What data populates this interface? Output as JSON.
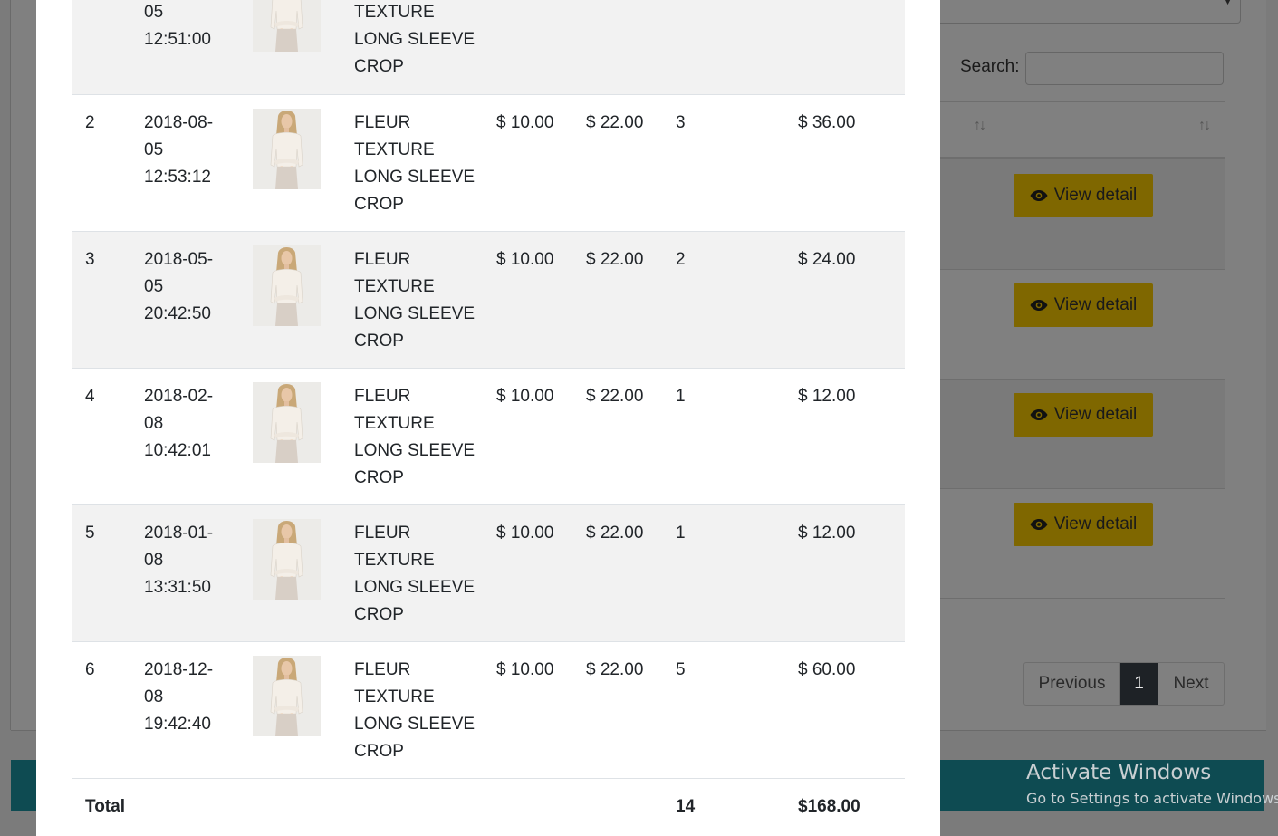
{
  "background": {
    "search_label": "Search:",
    "sort_icons": [
      "↑↓",
      "↑↓"
    ],
    "view_detail_buttons": [
      "View detail",
      "View detail",
      "View detail",
      "View detail"
    ],
    "pagination": {
      "previous": "Previous",
      "current": "1",
      "next": "Next"
    }
  },
  "watermark": {
    "title": "Activate Windows",
    "subtitle": "Go to Settings to activate Windows."
  },
  "modal": {
    "first_row_partial": {
      "date_lines": [
        "05",
        "12:51:00"
      ],
      "name_lines": [
        "TEXTURE",
        "LONG SLEEVE",
        "CROP"
      ]
    },
    "rows": [
      {
        "no": "2",
        "date_lines": [
          "2018-08-",
          "05",
          "12:53:12"
        ],
        "name_lines": [
          "FLEUR",
          "TEXTURE",
          "LONG SLEEVE",
          "CROP"
        ],
        "cost": "$ 10.00",
        "price": "$ 22.00",
        "qty": "3",
        "total": "$ 36.00"
      },
      {
        "no": "3",
        "date_lines": [
          "2018-05-",
          "05",
          "20:42:50"
        ],
        "name_lines": [
          "FLEUR",
          "TEXTURE",
          "LONG SLEEVE",
          "CROP"
        ],
        "cost": "$ 10.00",
        "price": "$ 22.00",
        "qty": "2",
        "total": "$ 24.00"
      },
      {
        "no": "4",
        "date_lines": [
          "2018-02-",
          "08",
          "10:42:01"
        ],
        "name_lines": [
          "FLEUR",
          "TEXTURE",
          "LONG SLEEVE",
          "CROP"
        ],
        "cost": "$ 10.00",
        "price": "$ 22.00",
        "qty": "1",
        "total": "$ 12.00"
      },
      {
        "no": "5",
        "date_lines": [
          "2018-01-",
          "08",
          "13:31:50"
        ],
        "name_lines": [
          "FLEUR",
          "TEXTURE",
          "LONG SLEEVE",
          "CROP"
        ],
        "cost": "$ 10.00",
        "price": "$ 22.00",
        "qty": "1",
        "total": "$ 12.00"
      },
      {
        "no": "6",
        "date_lines": [
          "2018-12-",
          "08",
          "19:42:40"
        ],
        "name_lines": [
          "FLEUR",
          "TEXTURE",
          "LONG SLEEVE",
          "CROP"
        ],
        "cost": "$ 10.00",
        "price": "$ 22.00",
        "qty": "5",
        "total": "$ 60.00"
      }
    ],
    "footer": {
      "label": "Total",
      "qty": "14",
      "total": "$168.00"
    }
  },
  "colors": {
    "button_yellow_dimmed": "#7f6700",
    "stripe": "#f2f2f2",
    "footer_bar_dimmed": "#0e4b52"
  },
  "icons": {
    "view_detail": "eye-icon",
    "product": "product-thumbnail"
  }
}
